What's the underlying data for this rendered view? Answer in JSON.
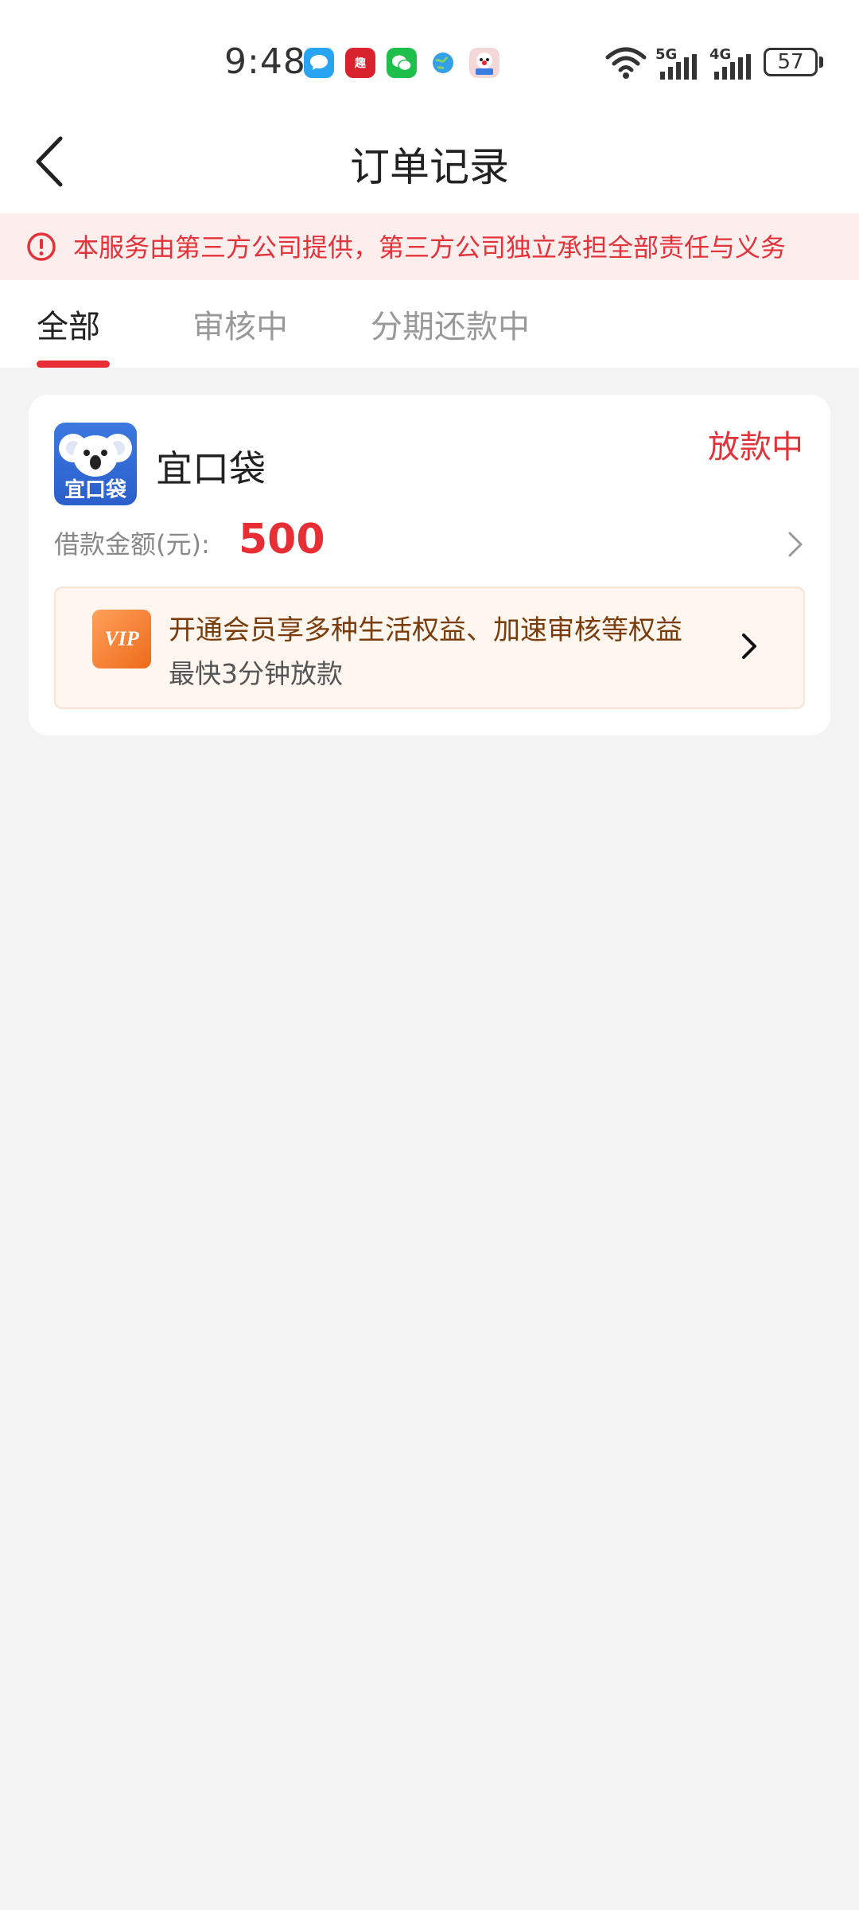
{
  "status_bar": {
    "time": "9:48",
    "battery": "57",
    "network1": "5G",
    "network2": "4G",
    "notif_icons": [
      "message-icon",
      "news-icon",
      "wechat-icon",
      "browser-icon",
      "game-icon"
    ],
    "icons": [
      "wifi-icon",
      "signal-5g-icon",
      "signal-4g-icon",
      "battery-icon"
    ]
  },
  "header": {
    "title": "订单记录",
    "back_icon": "back-arrow-icon"
  },
  "notice": {
    "text": "本服务由第三方公司提供，第三方公司独立承担全部责任与义务",
    "icon": "alert-circle-icon",
    "color": "#e2333a"
  },
  "tabs": [
    {
      "label": "全部",
      "active": true
    },
    {
      "label": "审核中",
      "active": false
    },
    {
      "label": "分期还款中",
      "active": false
    }
  ],
  "order": {
    "app_name": "宜口袋",
    "logo_text": "宜口袋",
    "status": "放款中",
    "amount_label": "借款金额(元):",
    "amount": "500",
    "chevron_icon": "chevron-right-icon"
  },
  "vip": {
    "icon_text": "VIP",
    "title": "开通会员享多种生活权益、加速审核等权益",
    "subtitle": "最快3分钟放款"
  },
  "colors": {
    "accent_red": "#e82e35",
    "background": "#f3f3f3",
    "notice_bg": "#fdeeee",
    "vip_bg": "#fff6f0"
  }
}
